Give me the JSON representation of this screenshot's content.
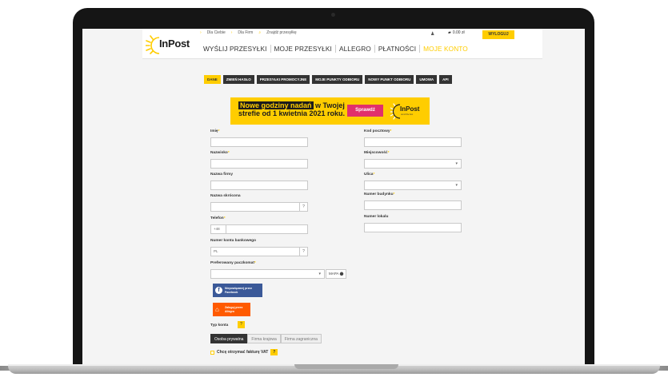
{
  "brand": {
    "logo_text": "InPost",
    "accent": "#ffcd00",
    "dark": "#1c1c1c"
  },
  "top_links": [
    "Dla Ciebie",
    "Dla Firm",
    "Znajdź przesyłkę"
  ],
  "wallet": "0.00 zł",
  "logout_label": "WYLOGUJ",
  "main_nav": [
    {
      "label": "WYŚLIJ PRZESYŁKI",
      "active": false
    },
    {
      "label": "MOJE PRZESYŁKI",
      "active": false
    },
    {
      "label": "ALLEGRO",
      "active": false
    },
    {
      "label": "PŁATNOŚCI",
      "active": false
    },
    {
      "label": "MOJE KONTO",
      "active": true
    }
  ],
  "sub_tabs": [
    {
      "label": "DANE",
      "active": true
    },
    {
      "label": "ZMIEŃ HASŁO",
      "active": false
    },
    {
      "label": "PRZESYŁKI PROMOCYJNE",
      "active": false
    },
    {
      "label": "MOJE PUNKTY ODBIORU",
      "active": false
    },
    {
      "label": "NOWY PUNKT ODBIORU",
      "active": false
    },
    {
      "label": "UMOWA",
      "active": false
    },
    {
      "label": "API",
      "active": false
    }
  ],
  "banner": {
    "line1_highlight": "Nowe godziny nadań",
    "line1_rest": " w Twojej",
    "line2": "strefie od 1 kwietnia 2021 roku.",
    "button": "Sprawdź",
    "logo_text": "InPost",
    "logo_sub": "out of the box"
  },
  "left_fields": {
    "imie": {
      "label": "Imię",
      "required": true
    },
    "nazwisko": {
      "label": "Nazwisko",
      "required": true
    },
    "firma": {
      "label": "Nazwa firmy",
      "required": false
    },
    "skrocona": {
      "label": "Nazwa skrócona",
      "required": false,
      "help": "?"
    },
    "telefon": {
      "label": "Telefon",
      "required": true,
      "prefix": "+48"
    },
    "konto": {
      "label": "Numer konta bankowego",
      "required": false,
      "prefix": "PL",
      "help": "?"
    },
    "paczkomat": {
      "label": "Preferowany paczkomat",
      "required": true,
      "map_label": "MAPA"
    }
  },
  "right_fields": {
    "kod": {
      "label": "Kod pocztowy",
      "required": true
    },
    "miejscowosc": {
      "label": "Miejscowość",
      "required": true
    },
    "ulica": {
      "label": "Ulica",
      "required": true
    },
    "budynek": {
      "label": "Numer budynku",
      "required": true
    },
    "lokal": {
      "label": "Numer lokalu",
      "required": false
    }
  },
  "req_mark": "*",
  "social": {
    "facebook": "Niepowiązanej przez Facebook",
    "allegro": "Zaloguj przez Allegro"
  },
  "account_type": {
    "label": "Typ konta",
    "help": "?",
    "options": [
      {
        "label": "Osoba prywatna",
        "selected": true
      },
      {
        "label": "Firma krajowa",
        "selected": false
      },
      {
        "label": "Firma zagraniczna",
        "selected": false
      }
    ]
  },
  "vat": {
    "label": "Chcę otrzymać fakturę VAT",
    "help": "?"
  }
}
